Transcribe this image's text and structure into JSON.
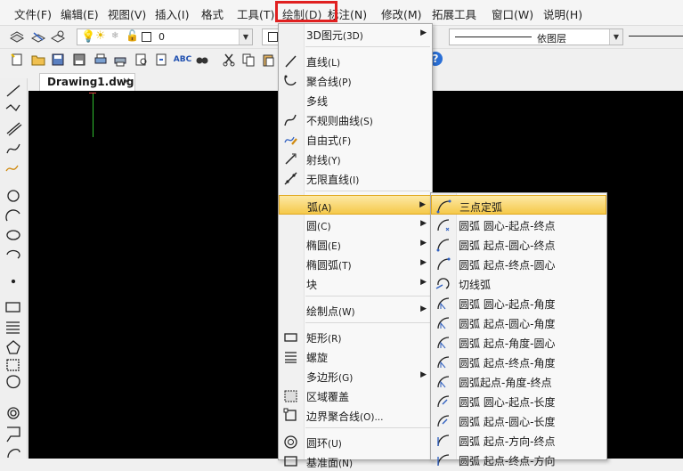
{
  "menubar": {
    "items": [
      "文件(F)",
      "编辑(E)",
      "视图(V)",
      "插入(I)",
      "格式",
      "工具(T)",
      "绘制(D)",
      "标注(N)",
      "修改(M)",
      "拓展工具",
      "窗口(W)",
      "说明(H)"
    ]
  },
  "toolbar1": {
    "layer_value": "0",
    "linetype_value": "依图层"
  },
  "toolbar2": {
    "help_glyph": "?"
  },
  "tabs": [
    {
      "label": "Drawing1.dwg",
      "close": "×"
    }
  ],
  "draw_menu": {
    "items": [
      {
        "label": "3D图元",
        "key": "(3D)",
        "submenu": "▶"
      },
      {
        "label": "直线",
        "key": "(L)"
      },
      {
        "label": "聚合线",
        "key": "(P)"
      },
      {
        "label": "多线",
        "key": ""
      },
      {
        "label": "不规则曲线",
        "key": "(S)"
      },
      {
        "label": "自由式",
        "key": "(F)"
      },
      {
        "label": "射线",
        "key": "(Y)"
      },
      {
        "label": "无限直线",
        "key": "(I)"
      },
      {
        "label": "弧",
        "key": "(A)",
        "submenu": "▶"
      },
      {
        "label": "圆",
        "key": "(C)",
        "submenu": "▶"
      },
      {
        "label": "椭圆",
        "key": "(E)",
        "submenu": "▶"
      },
      {
        "label": "椭圆弧",
        "key": "(T)",
        "submenu": "▶"
      },
      {
        "label": "块",
        "key": "",
        "submenu": "▶"
      },
      {
        "label": "绘制点",
        "key": "(W)",
        "submenu": "▶"
      },
      {
        "label": "矩形",
        "key": "(R)"
      },
      {
        "label": "螺旋",
        "key": ""
      },
      {
        "label": "多边形",
        "key": "(G)",
        "submenu": "▶"
      },
      {
        "label": "区域覆盖",
        "key": ""
      },
      {
        "label": "边界聚合线",
        "key": "(O)..."
      },
      {
        "label": "圆环",
        "key": "(U)"
      },
      {
        "label": "基准面",
        "key": "(N)"
      }
    ]
  },
  "arc_menu": {
    "items": [
      {
        "label": "三点定弧"
      },
      {
        "label": "圆弧 圆心-起点-终点"
      },
      {
        "label": "圆弧 起点-圆心-终点"
      },
      {
        "label": "圆弧 起点-终点-圆心"
      },
      {
        "label": "切线弧"
      },
      {
        "label": "圆弧 圆心-起点-角度"
      },
      {
        "label": "圆弧 起点-圆心-角度"
      },
      {
        "label": "圆弧 起点-角度-圆心"
      },
      {
        "label": "圆弧 起点-终点-角度"
      },
      {
        "label": "圆弧起点-角度-终点"
      },
      {
        "label": "圆弧 圆心-起点-长度"
      },
      {
        "label": "圆弧 起点-圆心-长度"
      },
      {
        "label": "圆弧 起点-方向-终点"
      },
      {
        "label": "圆弧 起点-终点-方向"
      }
    ]
  },
  "colors": {
    "highlight_box": "#e02020",
    "selected_row": "#f5c94a",
    "canvas": "#000000",
    "cursor": "#2fbf2f"
  }
}
